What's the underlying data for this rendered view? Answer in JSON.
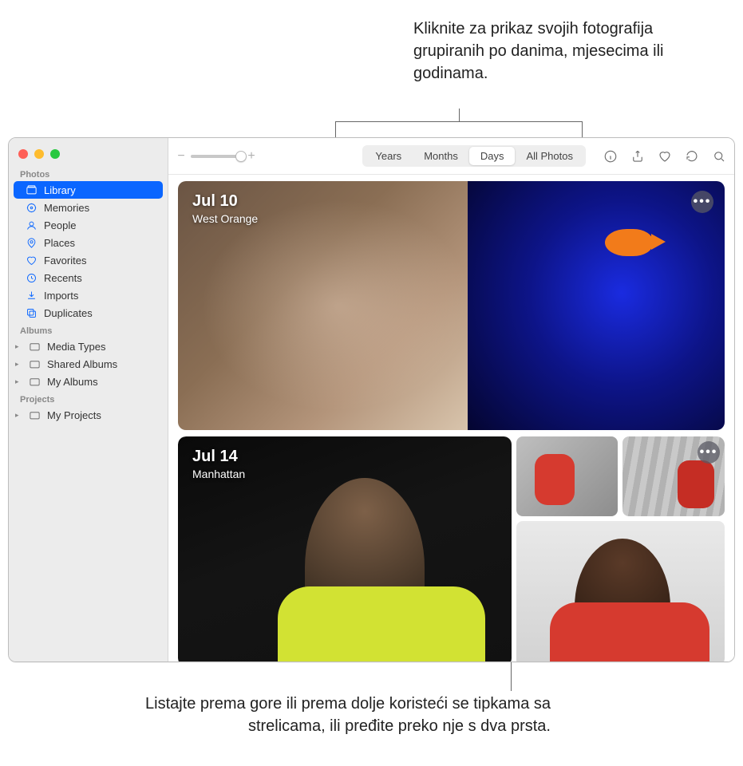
{
  "callouts": {
    "top": "Kliknite za prikaz svojih fotografija grupiranih po danima, mjesecima ili godinama.",
    "bottom": "Listajte prema gore ili prema dolje koristeći se tipkama sa strelicama, ili pređite preko nje s dva prsta."
  },
  "sidebar": {
    "sections": {
      "photos": "Photos",
      "albums": "Albums",
      "projects": "Projects"
    },
    "items": {
      "library": "Library",
      "memories": "Memories",
      "people": "People",
      "places": "Places",
      "favorites": "Favorites",
      "recents": "Recents",
      "imports": "Imports",
      "duplicates": "Duplicates",
      "media_types": "Media Types",
      "shared_albums": "Shared Albums",
      "my_albums": "My Albums",
      "my_projects": "My Projects"
    }
  },
  "toolbar": {
    "tabs": {
      "years": "Years",
      "months": "Months",
      "days": "Days",
      "all_photos": "All Photos"
    }
  },
  "days": [
    {
      "date": "Jul 10",
      "place": "West Orange"
    },
    {
      "date": "Jul 14",
      "place": "Manhattan"
    }
  ]
}
